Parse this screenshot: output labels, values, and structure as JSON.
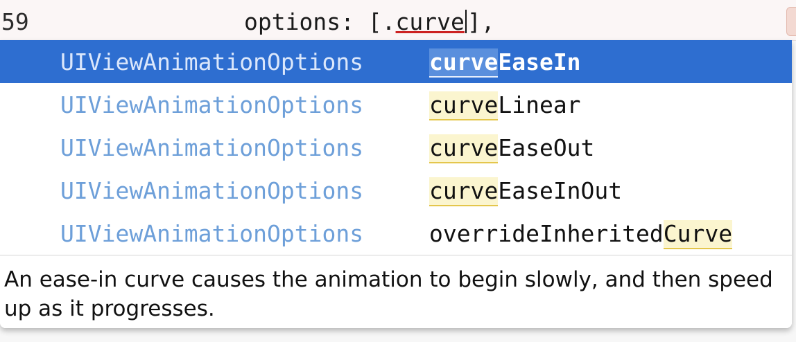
{
  "editor": {
    "line_number": "59",
    "code_prefix": "options: [.",
    "typed_text": "curve",
    "code_suffix": "],",
    "colors": {
      "typed_underline": "#cc2222"
    }
  },
  "completion": {
    "items": [
      {
        "type": "UIViewAnimationOptions",
        "match": "curve",
        "rest": "EaseIn",
        "prefix": "",
        "selected": true
      },
      {
        "type": "UIViewAnimationOptions",
        "match": "curve",
        "rest": "Linear",
        "prefix": "",
        "selected": false
      },
      {
        "type": "UIViewAnimationOptions",
        "match": "curve",
        "rest": "EaseOut",
        "prefix": "",
        "selected": false
      },
      {
        "type": "UIViewAnimationOptions",
        "match": "curve",
        "rest": "EaseInOut",
        "prefix": "",
        "selected": false
      },
      {
        "type": "UIViewAnimationOptions",
        "match": "Curve",
        "rest": "",
        "prefix": "overrideInherited",
        "selected": false
      }
    ],
    "colors": {
      "selection": "#2e6ed0",
      "type_text": "#6d9fd9",
      "match_highlight": "#fbf5cf"
    }
  },
  "documentation": {
    "text": "An ease-in curve causes the animation to begin slowly, and then speed up as it progresses."
  }
}
